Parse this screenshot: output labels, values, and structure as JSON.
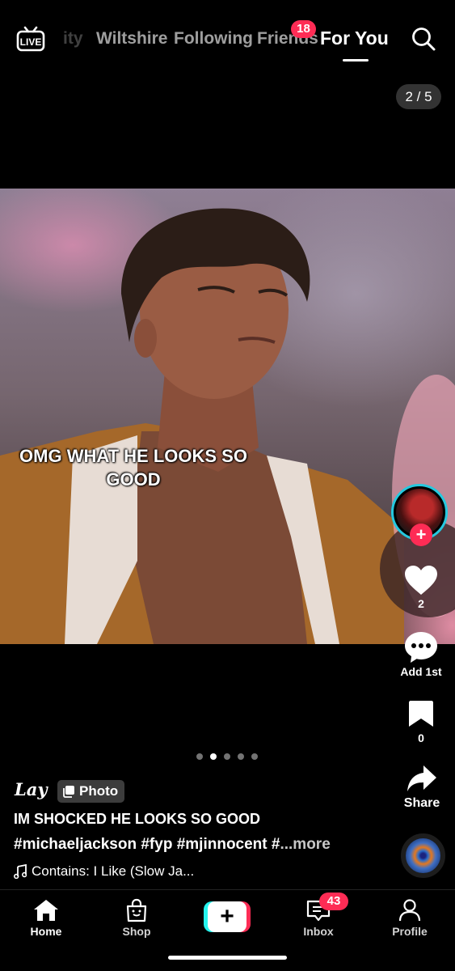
{
  "top_nav": {
    "live_icon_text": "LIVE",
    "tabs": [
      {
        "label": "ity"
      },
      {
        "label": "Wiltshire"
      },
      {
        "label": "Following"
      },
      {
        "label": "Friends",
        "badge": "18"
      },
      {
        "label": "For You",
        "active": true
      }
    ],
    "search_icon": "search-icon"
  },
  "media": {
    "counter": "2 / 5",
    "overlay_text": "OMG WHAT HE LOOKS SO GOOD",
    "page_dots_total": 5,
    "page_dots_active_index": 1
  },
  "right_rail": {
    "likes": "2",
    "comments_label": "Add 1st",
    "saves": "0",
    "share_label": "Share"
  },
  "caption": {
    "username": "Lay",
    "type_badge": "Photo",
    "title": "IM SHOCKED HE LOOKS SO GOOD",
    "hashtags": "#michaeljackson #fyp #mjinnocent #",
    "more": "...more",
    "music": "Contains: I Like (Slow Ja..."
  },
  "bottom_nav": {
    "items": [
      {
        "label": "Home",
        "icon": "home-icon",
        "active": true
      },
      {
        "label": "Shop",
        "icon": "shopping-bag-icon"
      },
      {
        "label": "",
        "icon": "plus-icon"
      },
      {
        "label": "Inbox",
        "icon": "inbox-icon",
        "badge": "43"
      },
      {
        "label": "Profile",
        "icon": "person-icon"
      }
    ]
  },
  "colors": {
    "accent_red": "#fe2c55",
    "accent_cyan": "#25f4ee",
    "avatar_ring": "#25c9df",
    "background": "#000000"
  }
}
